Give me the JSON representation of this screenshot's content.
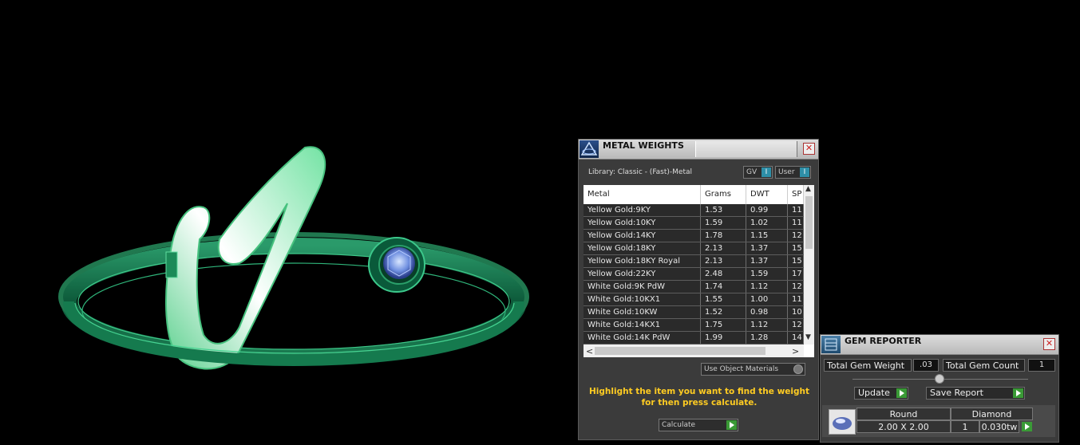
{
  "metal_weights": {
    "title": "METAL WEIGHTS",
    "library_label": "Library: Classic - (Fast)-Metal",
    "toggle_gv": "GV",
    "toggle_user": "User",
    "columns": [
      "Metal",
      "Grams",
      "DWT",
      "SP"
    ],
    "rows": [
      [
        "Yellow Gold:9KY",
        "1.53",
        "0.99",
        "11"
      ],
      [
        "Yellow Gold:10KY",
        "1.59",
        "1.02",
        "11"
      ],
      [
        "Yellow Gold:14KY",
        "1.78",
        "1.15",
        "12"
      ],
      [
        "Yellow Gold:18KY",
        "2.13",
        "1.37",
        "15"
      ],
      [
        "Yellow Gold:18KY Royal",
        "2.13",
        "1.37",
        "15"
      ],
      [
        "Yellow Gold:22KY",
        "2.48",
        "1.59",
        "17"
      ],
      [
        "White Gold:9K PdW",
        "1.74",
        "1.12",
        "12"
      ],
      [
        "White Gold:10KX1",
        "1.55",
        "1.00",
        "11"
      ],
      [
        "White Gold:10KW",
        "1.52",
        "0.98",
        "10"
      ],
      [
        "White Gold:14KX1",
        "1.75",
        "1.12",
        "12"
      ],
      [
        "White Gold:14K PdW",
        "1.99",
        "1.28",
        "14"
      ]
    ],
    "use_object_materials": "Use Object Materials",
    "hint": "Highlight the item you want to find the weight for then press calculate.",
    "calculate_label": "Calculate"
  },
  "gem_reporter": {
    "title": "GEM REPORTER",
    "total_weight_label": "Total Gem Weight",
    "total_weight_value": ".03",
    "total_count_label": "Total Gem Count",
    "total_count_value": "1",
    "update_label": "Update",
    "save_report_label": "Save Report",
    "gem": {
      "shape": "Round",
      "type": "Diamond",
      "size": "2.00 X 2.00",
      "count": "1",
      "weight": "0.030tw"
    }
  }
}
